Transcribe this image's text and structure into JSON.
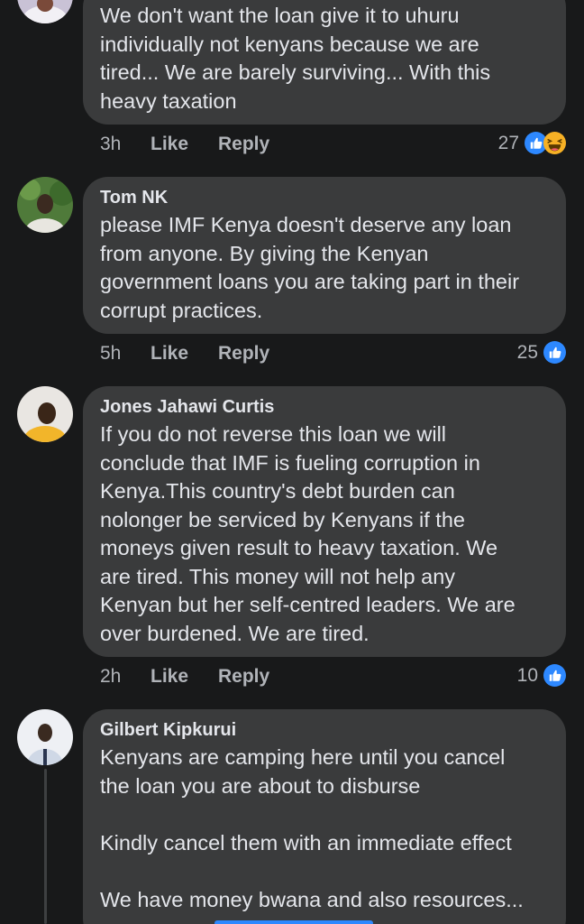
{
  "comments": [
    {
      "author": "",
      "text": "We don't want the loan give it to uhuru\nindividually not kenyans because we are\ntired... We are barely surviving... With this\nheavy taxation",
      "time": "3h",
      "like_label": "Like",
      "reply_label": "Reply",
      "reaction_count": "27",
      "reactions": [
        "like-icon",
        "haha-icon"
      ]
    },
    {
      "author": "Tom NK",
      "text": "please IMF Kenya doesn't deserve any loan\nfrom anyone. By giving the Kenyan\ngovernment loans you are taking part in their\ncorrupt practices.",
      "time": "5h",
      "like_label": "Like",
      "reply_label": "Reply",
      "reaction_count": "25",
      "reactions": [
        "like-icon"
      ]
    },
    {
      "author": "Jones Jahawi Curtis",
      "text": "If you do not reverse this loan we will\nconclude that IMF is fueling corruption in\nKenya.This country's debt burden can\nnolonger be serviced by Kenyans if the\nmoneys given result to heavy taxation. We\nare tired. This money will not help any\nKenyan but her self-centred leaders. We are\nover burdened. We are tired.",
      "time": "2h",
      "like_label": "Like",
      "reply_label": "Reply",
      "reaction_count": "10",
      "reactions": [
        "like-icon"
      ]
    },
    {
      "author": "Gilbert Kipkurui",
      "text": "Kenyans are camping here until you cancel\nthe loan you are about to disburse\n\nKindly cancel them with an immediate effect\n\nWe have money bwana and also resources..."
    }
  ],
  "colors": {
    "background": "#18191a",
    "bubble": "#3a3b3c",
    "text": "#e4e6eb",
    "meta": "#b0b3b8",
    "like_blue": "#2d88ff",
    "haha_yellow": "#f7b125"
  }
}
